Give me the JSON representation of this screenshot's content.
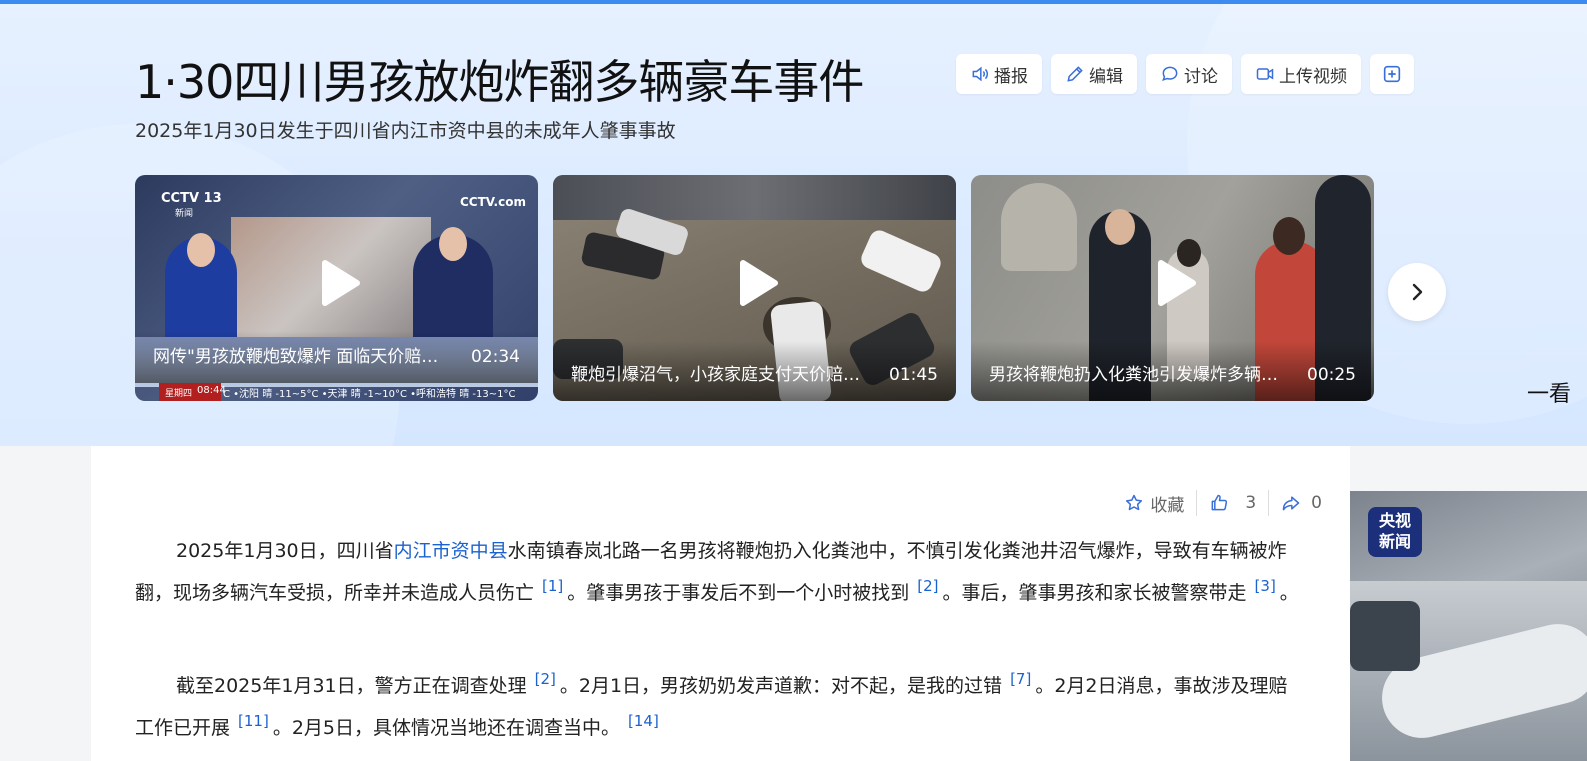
{
  "header": {
    "title": "1·30四川男孩放炮炸翻多辆豪车事件",
    "subtitle": "2025年1月30日发生于四川省内江市资中县的未成年人肇事事故",
    "actions": {
      "play": "播报",
      "edit": "编辑",
      "discuss": "讨论",
      "upload": "上传视频"
    }
  },
  "videos": [
    {
      "title": "网传\"男孩放鞭炮致爆炸 面临天价赔偿\"",
      "duration": "02:34",
      "icon": "play-icon"
    },
    {
      "title": "鞭炮引爆沼气，小孩家庭支付天价赔偿？",
      "duration": "01:45",
      "icon": "play-icon"
    },
    {
      "title": "男孩将鞭炮扔入化粪池引发爆炸多辆车被炸翻",
      "duration": "00:25",
      "icon": "play-icon"
    }
  ],
  "video1_overlay": {
    "logo_left": "CCTV 13",
    "logo_left_sub": "新闻",
    "logo_right": "CCTV.com",
    "ticker_day": "星期四",
    "ticker_time": "08:44",
    "ticker_weather": "C •沈阳 晴 -11~5°C •天津 晴 -1~10°C •呼和浩特 晴 -13~1°C"
  },
  "side_peek_text": "一看",
  "toolbar": {
    "collect_label": "收藏",
    "like_count": "3",
    "share_count": "0"
  },
  "article": {
    "p1_a": "2025年1月30日，四川省",
    "p1_link": "内江市资中县",
    "p1_b": "水南镇春岚北路一名男孩将鞭炮扔入化粪池中，不慎引发化粪池井沼气爆炸，导致有车辆被炸翻，现场多辆汽车受损，所幸并未造成人员伤亡",
    "p1_ref1": "[1]",
    "p1_c": "。肇事男孩于事发后不到一个小时被找到",
    "p1_ref2": "[2]",
    "p1_d": "。事后，肇事男孩和家长被警察带走",
    "p1_ref3": "[3]",
    "p1_e": "。",
    "p2_a": "截至2025年1月31日，警方正在调查处理",
    "p2_ref1": "[2]",
    "p2_b": "。2月1日，男孩奶奶发声道歉：对不起，是我的过错",
    "p2_ref2": "[7]",
    "p2_c": "。2月2日消息，事故涉及理赔工作已开展",
    "p2_ref3": "[11]",
    "p2_d": "。2月5日，具体情况当地还在调查当中。",
    "p2_ref4": "[14]"
  },
  "side_image": {
    "badge_line1": "央视",
    "badge_line2": "新闻"
  }
}
